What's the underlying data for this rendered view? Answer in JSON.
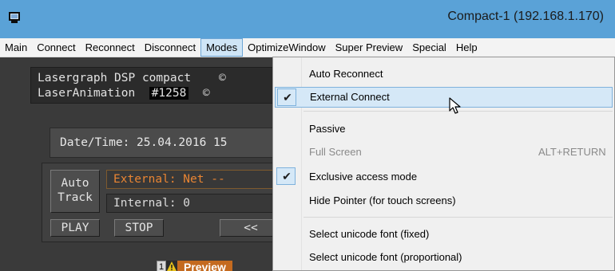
{
  "window": {
    "title": "Compact-1 (192.168.1.170)",
    "icon": "monitor-icon"
  },
  "menubar": {
    "items": [
      "Main",
      "Connect",
      "Reconnect",
      "Disconnect",
      "Modes",
      "OptimizeWindow",
      "Super Preview",
      "Special",
      "Help"
    ],
    "active": "Modes"
  },
  "app": {
    "device_line1_name": "Lasergraph DSP compact",
    "device_line1_trail": "©",
    "device_line2_name": "LaserAnimation",
    "device_line2_serial": "#1258",
    "device_line2_trail": "©",
    "datetime": "Date/Time: 25.04.2016  15",
    "auto_track_line1": "Auto",
    "auto_track_line2": "Track",
    "external_field": "External: Net    --",
    "internal_field": "Internal:        0",
    "play_label": "PLAY",
    "stop_label": "STOP",
    "prev_label": "<<",
    "preview_number": "1",
    "preview_label": "Preview"
  },
  "modes_menu": {
    "items": [
      {
        "label": "Auto Reconnect",
        "checked": false,
        "enabled": true,
        "highlighted": false
      },
      {
        "label": "External Connect",
        "checked": true,
        "enabled": true,
        "highlighted": true
      },
      {
        "label": "Passive",
        "checked": false,
        "enabled": true,
        "highlighted": false
      },
      {
        "label": "Full Screen",
        "checked": false,
        "enabled": false,
        "highlighted": false,
        "shortcut": "ALT+RETURN"
      },
      {
        "label": "Exclusive access mode",
        "checked": true,
        "enabled": true,
        "highlighted": false
      },
      {
        "label": "Hide Pointer (for touch screens)",
        "checked": false,
        "enabled": true,
        "highlighted": false
      },
      {
        "label": "Select unicode font (fixed)",
        "checked": false,
        "enabled": true,
        "highlighted": false
      },
      {
        "label": "Select unicode font (proportional)",
        "checked": false,
        "enabled": true,
        "highlighted": false
      }
    ],
    "check_glyph": "✔"
  },
  "colors": {
    "titlebar": "#5aa2d7",
    "menu_highlight": "#d5e8f7",
    "external_text": "#e98533",
    "preview_tab": "#c46a1f",
    "app_background": "#3a3a3a"
  }
}
